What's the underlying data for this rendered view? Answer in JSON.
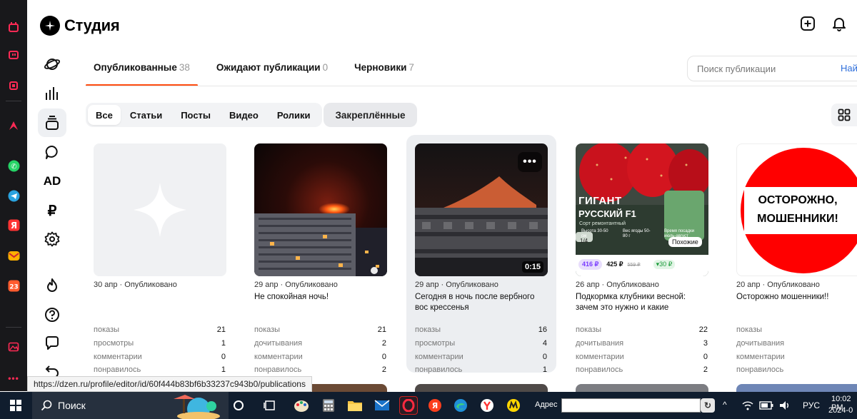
{
  "app": {
    "title": "Студия"
  },
  "status_url": "https://dzen.ru/profile/editor/id/60f444b83bf6b33237c943b0/publications",
  "nav": {
    "ad_label": "AD",
    "ruble_label": "₽"
  },
  "tabs": [
    {
      "label": "Опубликованные",
      "count": "38"
    },
    {
      "label": "Ожидают публикации",
      "count": "0"
    },
    {
      "label": "Черновики",
      "count": "7"
    }
  ],
  "search": {
    "placeholder": "Поиск публикации",
    "button": "Най"
  },
  "filters": [
    "Все",
    "Статьи",
    "Посты",
    "Видео",
    "Ролики"
  ],
  "pinned_label": "Закреплённые",
  "cards": [
    {
      "meta": "30 апр · Опубликовано",
      "title": "",
      "stats": [
        [
          "показы",
          "21"
        ],
        [
          "просмотры",
          "1"
        ],
        [
          "комментарии",
          "0"
        ],
        [
          "понравилось",
          "1"
        ]
      ]
    },
    {
      "meta": "29 апр · Опубликовано",
      "title": "Не спокойная ночь!",
      "stats": [
        [
          "показы",
          "21"
        ],
        [
          "дочитывания",
          "2"
        ],
        [
          "комментарии",
          "0"
        ],
        [
          "понравилось",
          "2"
        ]
      ]
    },
    {
      "meta": "29 апр · Опубликовано",
      "title": "Сегодня в ночь после вербного вос кресcенья",
      "duration": "0:15",
      "more": "•••",
      "stats": [
        [
          "показы",
          "16"
        ],
        [
          "просмотры",
          "4"
        ],
        [
          "комментарии",
          "0"
        ],
        [
          "понравилось",
          "1"
        ]
      ]
    },
    {
      "meta": "26 апр · Опубликовано",
      "title": "Подкормка клубники весной: зачем это нужно и какие удобрения выб…",
      "thumb": {
        "big": "ГИГАНТ",
        "name": "РУССКИЙ F1",
        "sub": "Сорт ремонтантный",
        "similar": "Похожие",
        "counter": "1/4",
        "price": "416 ₽",
        "price2": "425 ₽",
        "old": "559 ₽",
        "disc": "▾30 ₽",
        "f1": "Высота 30-50 см",
        "f2": "Вес ягоды 50-80 г",
        "f3": "Время посадки июль-август"
      },
      "stats": [
        [
          "показы",
          "22"
        ],
        [
          "дочитывания",
          "3"
        ],
        [
          "комментарии",
          "0"
        ],
        [
          "понравилось",
          "2"
        ]
      ]
    },
    {
      "meta": "20 апр · Опубликовано",
      "title": "Осторожно мошенники!!",
      "thumb": {
        "line1": "ОСТОРОЖНО,",
        "line2": "МОШЕННИКИ!"
      },
      "stats": [
        [
          "показы",
          ""
        ],
        [
          "дочитывания",
          ""
        ],
        [
          "комментарии",
          ""
        ],
        [
          "понравилось",
          ""
        ]
      ]
    }
  ],
  "taskbar": {
    "search": "Поиск",
    "address_label": "Адрес",
    "lang": "РУС",
    "time": "10:02 PM",
    "date": "2024-0"
  },
  "colors": {
    "accent": "#ff4d11",
    "link": "#2f6fdb",
    "taskbar": "#101d2e",
    "rail": "#18181b"
  }
}
